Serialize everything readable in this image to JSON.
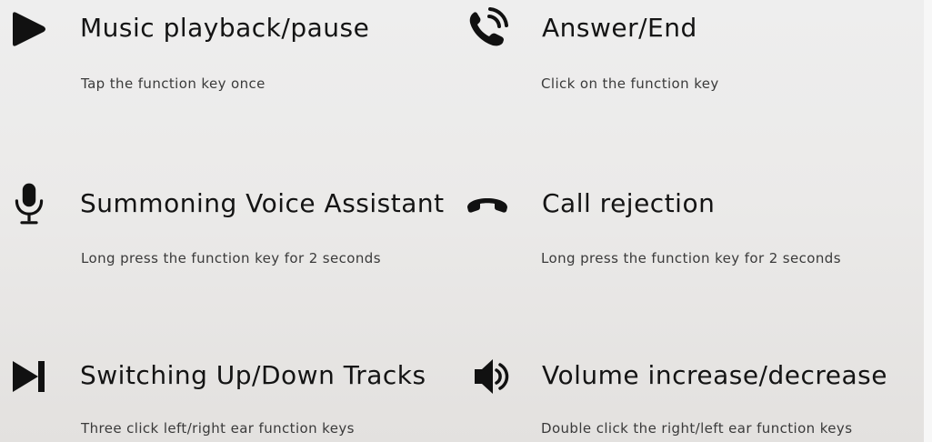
{
  "features": [
    {
      "icon": "play-icon",
      "title": "Music playback/pause",
      "description": "Tap the function key once"
    },
    {
      "icon": "phone-ringing-icon",
      "title": "Answer/End",
      "description": "Click on the function key"
    },
    {
      "icon": "microphone-icon",
      "title": "Summoning Voice Assistant",
      "description": "Long press the function key for 2 seconds"
    },
    {
      "icon": "hang-up-icon",
      "title": "Call rejection",
      "description": "Long press the function key for 2 seconds"
    },
    {
      "icon": "skip-track-icon",
      "title": "Switching Up/Down Tracks",
      "description": "Three click left/right ear function keys"
    },
    {
      "icon": "speaker-volume-icon",
      "title": "Volume increase/decrease",
      "description": "Double click the right/left ear function keys"
    }
  ],
  "colors": {
    "text": "#141414",
    "description": "#3a3a3a",
    "background": "#ebeae9"
  }
}
